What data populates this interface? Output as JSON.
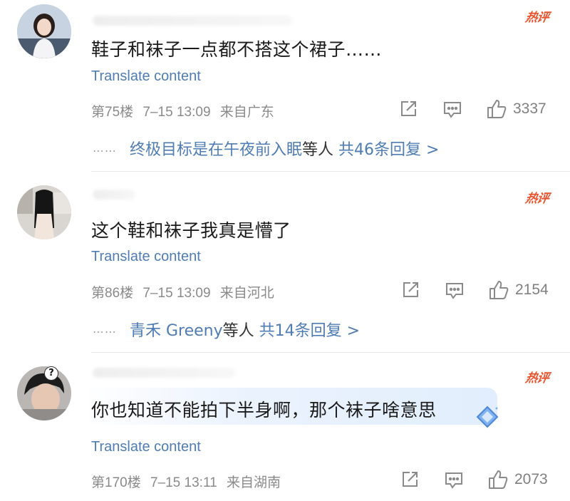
{
  "comments": [
    {
      "text": "鞋子和袜子一点都不搭这个裙子……",
      "translate": "Translate content",
      "floor": "第75楼",
      "date": "7–15 13:09",
      "location": "来自广东",
      "likes": "3337",
      "hot_label": "热评",
      "reply_names": "终极目标是在午夜前入眠",
      "reply_others": "等人",
      "reply_count": "共46条回复 >"
    },
    {
      "text": "这个鞋和袜子我真是懵了",
      "translate": "Translate content",
      "floor": "第86楼",
      "date": "7–15 13:09",
      "location": "来自河北",
      "likes": "2154",
      "hot_label": "热评",
      "reply_names": "青禾 Greeny",
      "reply_others": "等人",
      "reply_count": "共14条回复 >"
    },
    {
      "text": "你也知道不能拍下半身啊，那个袜子啥意思",
      "translate": "Translate content",
      "floor": "第170楼",
      "date": "7–15 13:11",
      "location": "来自湖南",
      "likes": "2073",
      "hot_label": "热评"
    }
  ],
  "reply_dots": "⋯⋯",
  "colors": {
    "link": "#4f7cb3",
    "hot": "#e8532e",
    "meta": "#8a8a8a"
  },
  "icons": [
    "share-icon",
    "comment-icon",
    "thumbs-up-icon",
    "diamond-badge-icon"
  ]
}
